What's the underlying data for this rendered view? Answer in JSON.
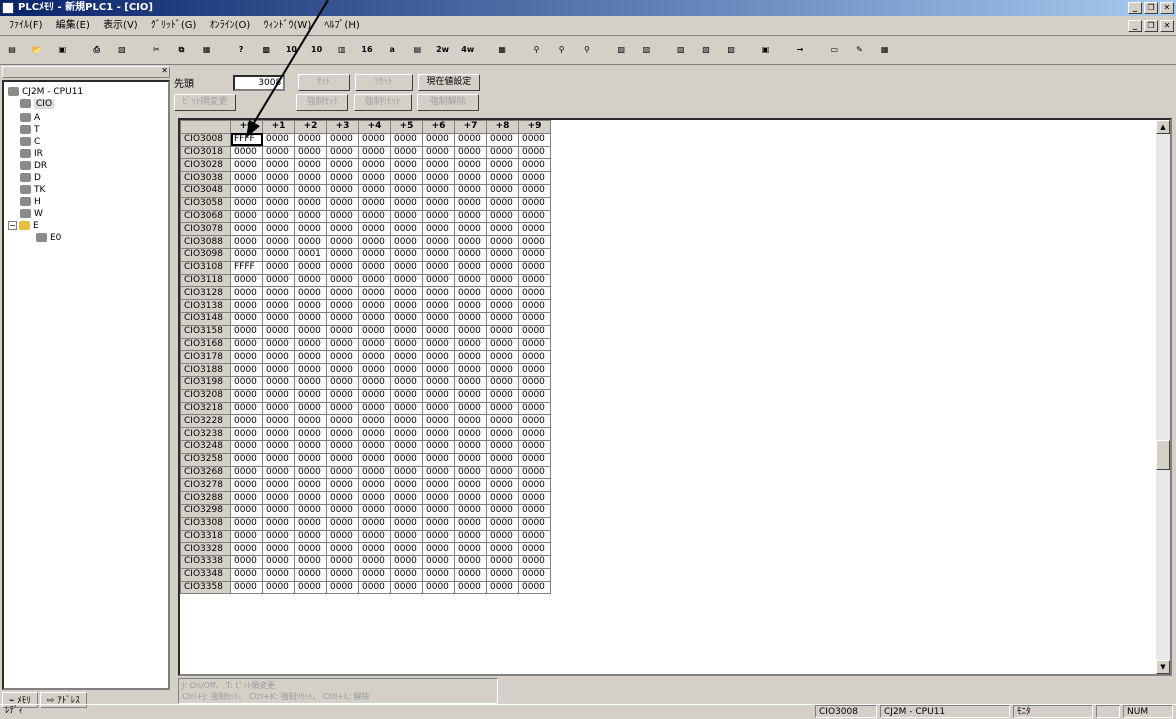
{
  "window": {
    "title": "PLCﾒﾓﾘ - 新規PLC1 - [CIO]"
  },
  "menu": [
    "ﾌｧｲﾙ(F)",
    "編集(E)",
    "表示(V)",
    "ｸﾞﾘｯﾄﾞ(G)",
    "ｵﾝﾗｲﾝ(O)",
    "ｳｨﾝﾄﾞｳ(W)",
    "ﾍﾙﾌﾟ(H)"
  ],
  "toolbar": [
    "new-icon",
    "open-icon",
    "save-icon",
    "print-icon",
    "preview-icon",
    "cut-icon",
    "copy-icon",
    "paste-icon",
    "help-icon",
    "monitor-icon",
    "decimal-icon",
    "signed-decimal-icon",
    "bcd-icon",
    "hex-icon",
    "ascii-icon",
    "float-icon",
    "2-word-icon",
    "4-word-icon",
    "calc-icon",
    "find-icon",
    "zoom-in-icon",
    "zoom-out-icon",
    "transfer-icon",
    "compare-icon",
    "download-icon",
    "upload-icon",
    "verify-icon",
    "online-icon",
    "clear-icon",
    "settings-icon",
    "edit-icon",
    "table-icon"
  ],
  "toolbar_text": {
    "b10": "10",
    "b16": "16",
    "ba": "a",
    "b2w": "2w",
    "b4w": "4w"
  },
  "sidebar": {
    "root": "CJ2M - CPU11",
    "items": [
      {
        "label": "CIO",
        "selected": true
      },
      {
        "label": "A"
      },
      {
        "label": "T"
      },
      {
        "label": "C"
      },
      {
        "label": "IR"
      },
      {
        "label": "DR"
      },
      {
        "label": "D"
      },
      {
        "label": "TK"
      },
      {
        "label": "H"
      },
      {
        "label": "W"
      },
      {
        "label": "E"
      },
      {
        "label": "E0"
      }
    ],
    "tabs": {
      "memory": "ﾒﾓﾘ",
      "address": "ｱﾄﾞﾚｽ"
    }
  },
  "controls": {
    "start_label": "先頭",
    "start_value": "3008",
    "set": "ｾｯﾄ",
    "reset": "ﾘｾｯﾄ",
    "present_value": "現在値設定",
    "bit_order": "ﾋﾞｯﾄ順変更",
    "force_set": "強制ｾｯﾄ",
    "force_reset": "強制ﾘｾｯﾄ",
    "force_release": "強制解除"
  },
  "grid": {
    "headers": [
      "+0",
      "+1",
      "+2",
      "+3",
      "+4",
      "+5",
      "+6",
      "+7",
      "+8",
      "+9"
    ],
    "rows": [
      {
        "addr": "CIO3008",
        "values": [
          "FFFF",
          "0000",
          "0000",
          "0000",
          "0000",
          "0000",
          "0000",
          "0000",
          "0000",
          "0000"
        ]
      },
      {
        "addr": "CIO3018",
        "values": [
          "0000",
          "0000",
          "0000",
          "0000",
          "0000",
          "0000",
          "0000",
          "0000",
          "0000",
          "0000"
        ]
      },
      {
        "addr": "CIO3028",
        "values": [
          "0000",
          "0000",
          "0000",
          "0000",
          "0000",
          "0000",
          "0000",
          "0000",
          "0000",
          "0000"
        ]
      },
      {
        "addr": "CIO3038",
        "values": [
          "0000",
          "0000",
          "0000",
          "0000",
          "0000",
          "0000",
          "0000",
          "0000",
          "0000",
          "0000"
        ]
      },
      {
        "addr": "CIO3048",
        "values": [
          "0000",
          "0000",
          "0000",
          "0000",
          "0000",
          "0000",
          "0000",
          "0000",
          "0000",
          "0000"
        ]
      },
      {
        "addr": "CIO3058",
        "values": [
          "0000",
          "0000",
          "0000",
          "0000",
          "0000",
          "0000",
          "0000",
          "0000",
          "0000",
          "0000"
        ]
      },
      {
        "addr": "CIO3068",
        "values": [
          "0000",
          "0000",
          "0000",
          "0000",
          "0000",
          "0000",
          "0000",
          "0000",
          "0000",
          "0000"
        ]
      },
      {
        "addr": "CIO3078",
        "values": [
          "0000",
          "0000",
          "0000",
          "0000",
          "0000",
          "0000",
          "0000",
          "0000",
          "0000",
          "0000"
        ]
      },
      {
        "addr": "CIO3088",
        "values": [
          "0000",
          "0000",
          "0000",
          "0000",
          "0000",
          "0000",
          "0000",
          "0000",
          "0000",
          "0000"
        ]
      },
      {
        "addr": "CIO3098",
        "values": [
          "0000",
          "0000",
          "0001",
          "0000",
          "0000",
          "0000",
          "0000",
          "0000",
          "0000",
          "0000"
        ]
      },
      {
        "addr": "CIO3108",
        "values": [
          "FFFF",
          "0000",
          "0000",
          "0000",
          "0000",
          "0000",
          "0000",
          "0000",
          "0000",
          "0000"
        ]
      },
      {
        "addr": "CIO3118",
        "values": [
          "0000",
          "0000",
          "0000",
          "0000",
          "0000",
          "0000",
          "0000",
          "0000",
          "0000",
          "0000"
        ]
      },
      {
        "addr": "CIO3128",
        "values": [
          "0000",
          "0000",
          "0000",
          "0000",
          "0000",
          "0000",
          "0000",
          "0000",
          "0000",
          "0000"
        ]
      },
      {
        "addr": "CIO3138",
        "values": [
          "0000",
          "0000",
          "0000",
          "0000",
          "0000",
          "0000",
          "0000",
          "0000",
          "0000",
          "0000"
        ]
      },
      {
        "addr": "CIO3148",
        "values": [
          "0000",
          "0000",
          "0000",
          "0000",
          "0000",
          "0000",
          "0000",
          "0000",
          "0000",
          "0000"
        ]
      },
      {
        "addr": "CIO3158",
        "values": [
          "0000",
          "0000",
          "0000",
          "0000",
          "0000",
          "0000",
          "0000",
          "0000",
          "0000",
          "0000"
        ]
      },
      {
        "addr": "CIO3168",
        "values": [
          "0000",
          "0000",
          "0000",
          "0000",
          "0000",
          "0000",
          "0000",
          "0000",
          "0000",
          "0000"
        ]
      },
      {
        "addr": "CIO3178",
        "values": [
          "0000",
          "0000",
          "0000",
          "0000",
          "0000",
          "0000",
          "0000",
          "0000",
          "0000",
          "0000"
        ]
      },
      {
        "addr": "CIO3188",
        "values": [
          "0000",
          "0000",
          "0000",
          "0000",
          "0000",
          "0000",
          "0000",
          "0000",
          "0000",
          "0000"
        ]
      },
      {
        "addr": "CIO3198",
        "values": [
          "0000",
          "0000",
          "0000",
          "0000",
          "0000",
          "0000",
          "0000",
          "0000",
          "0000",
          "0000"
        ]
      },
      {
        "addr": "CIO3208",
        "values": [
          "0000",
          "0000",
          "0000",
          "0000",
          "0000",
          "0000",
          "0000",
          "0000",
          "0000",
          "0000"
        ]
      },
      {
        "addr": "CIO3218",
        "values": [
          "0000",
          "0000",
          "0000",
          "0000",
          "0000",
          "0000",
          "0000",
          "0000",
          "0000",
          "0000"
        ]
      },
      {
        "addr": "CIO3228",
        "values": [
          "0000",
          "0000",
          "0000",
          "0000",
          "0000",
          "0000",
          "0000",
          "0000",
          "0000",
          "0000"
        ]
      },
      {
        "addr": "CIO3238",
        "values": [
          "0000",
          "0000",
          "0000",
          "0000",
          "0000",
          "0000",
          "0000",
          "0000",
          "0000",
          "0000"
        ]
      },
      {
        "addr": "CIO3248",
        "values": [
          "0000",
          "0000",
          "0000",
          "0000",
          "0000",
          "0000",
          "0000",
          "0000",
          "0000",
          "0000"
        ]
      },
      {
        "addr": "CIO3258",
        "values": [
          "0000",
          "0000",
          "0000",
          "0000",
          "0000",
          "0000",
          "0000",
          "0000",
          "0000",
          "0000"
        ]
      },
      {
        "addr": "CIO3268",
        "values": [
          "0000",
          "0000",
          "0000",
          "0000",
          "0000",
          "0000",
          "0000",
          "0000",
          "0000",
          "0000"
        ]
      },
      {
        "addr": "CIO3278",
        "values": [
          "0000",
          "0000",
          "0000",
          "0000",
          "0000",
          "0000",
          "0000",
          "0000",
          "0000",
          "0000"
        ]
      },
      {
        "addr": "CIO3288",
        "values": [
          "0000",
          "0000",
          "0000",
          "0000",
          "0000",
          "0000",
          "0000",
          "0000",
          "0000",
          "0000"
        ]
      },
      {
        "addr": "CIO3298",
        "values": [
          "0000",
          "0000",
          "0000",
          "0000",
          "0000",
          "0000",
          "0000",
          "0000",
          "0000",
          "0000"
        ]
      },
      {
        "addr": "CIO3308",
        "values": [
          "0000",
          "0000",
          "0000",
          "0000",
          "0000",
          "0000",
          "0000",
          "0000",
          "0000",
          "0000"
        ]
      },
      {
        "addr": "CIO3318",
        "values": [
          "0000",
          "0000",
          "0000",
          "0000",
          "0000",
          "0000",
          "0000",
          "0000",
          "0000",
          "0000"
        ]
      },
      {
        "addr": "CIO3328",
        "values": [
          "0000",
          "0000",
          "0000",
          "0000",
          "0000",
          "0000",
          "0000",
          "0000",
          "0000",
          "0000"
        ]
      },
      {
        "addr": "CIO3338",
        "values": [
          "0000",
          "0000",
          "0000",
          "0000",
          "0000",
          "0000",
          "0000",
          "0000",
          "0000",
          "0000"
        ]
      },
      {
        "addr": "CIO3348",
        "values": [
          "0000",
          "0000",
          "0000",
          "0000",
          "0000",
          "0000",
          "0000",
          "0000",
          "0000",
          "0000"
        ]
      },
      {
        "addr": "CIO3358",
        "values": [
          "0000",
          "0000",
          "0000",
          "0000",
          "0000",
          "0000",
          "0000",
          "0000",
          "0000",
          "0000"
        ]
      }
    ]
  },
  "hint": {
    "line1": "J: On/Off、 T: ﾋﾞｯﾄ順変更",
    "line2": "Ctrl+J: 強制ｾｯﾄ、 Ctrl+K: 強制ﾘｾｯﾄ、 Ctrl+L: 解除"
  },
  "status": {
    "ready": "ﾚﾃﾞｨ",
    "address": "CIO3008",
    "plc": "CJ2M - CPU11",
    "mode": "ﾓﾆﾀ",
    "num": "NUM"
  },
  "colors": {
    "titlebar": "#0a246a",
    "face": "#d4d0c8"
  }
}
